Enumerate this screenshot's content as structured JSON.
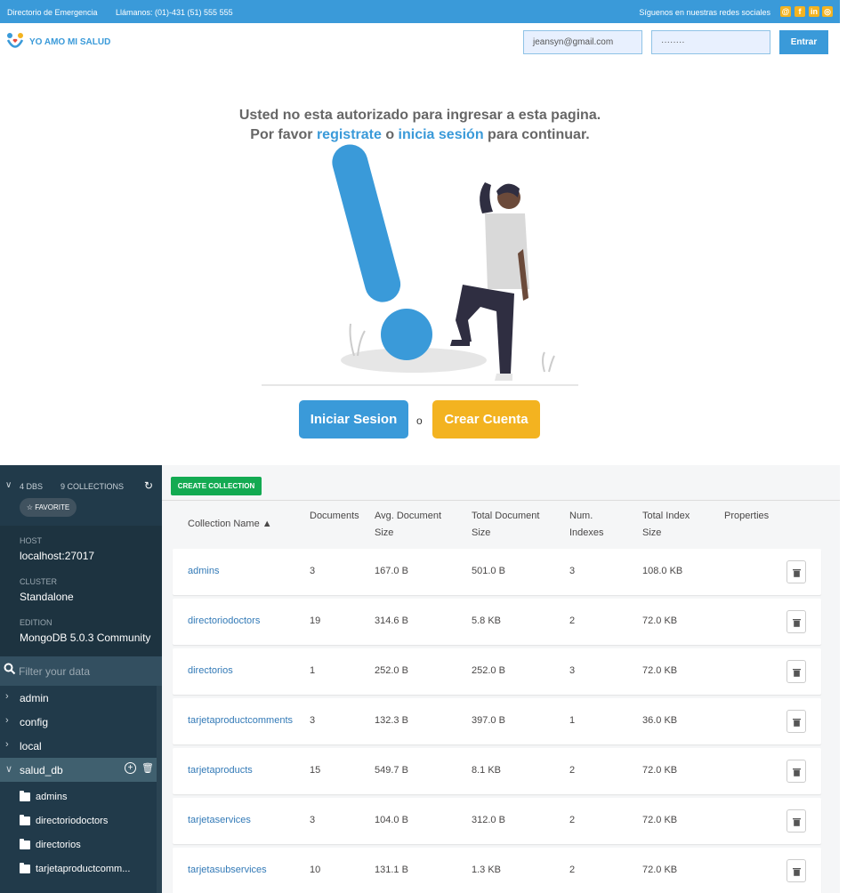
{
  "topbar": {
    "left_text": "Directorio de Emergencia",
    "phone_text": "Llámanos: (01)-431 (51) 555 555",
    "right_text": "Síguenos en nuestras redes sociales",
    "social_icons": [
      "email-icon",
      "facebook-icon",
      "linkedin-icon",
      "instagram-icon"
    ]
  },
  "header": {
    "logo_text": "YO AMO MI SALUD",
    "email_value": "jeansyn@gmail.com",
    "password_value": "········",
    "submit_label": "Entrar"
  },
  "message": {
    "line1": "Usted no esta autorizado para ingresar a esta pagina.",
    "line2_prefix": "Por favor ",
    "register_link": "registrate",
    "connector": " o ",
    "login_link": "inicia sesión",
    "line2_suffix": " para continuar."
  },
  "actions": {
    "login_label": "Iniciar Sesion",
    "separator": "o",
    "create_label": "Crear Cuenta"
  },
  "colors": {
    "brand_blue": "#3a9ad9",
    "brand_yellow": "#f3b320",
    "sidebar_bg": "#213a4a",
    "compass_green": "#13aa52",
    "link_blue": "#337ab7"
  },
  "sidebar": {
    "dbs_label": "4 DBS",
    "collections_label": "9 COLLECTIONS",
    "favorite_label": "☆ FAVORITE",
    "host_label": "HOST",
    "host_value": "localhost:27017",
    "cluster_label": "CLUSTER",
    "cluster_value": "Standalone",
    "edition_label": "EDITION",
    "edition_value": "MongoDB 5.0.3 Community",
    "filter_placeholder": "Filter your data",
    "databases": [
      "admin",
      "config",
      "local",
      "salud_db"
    ],
    "collections": [
      "admins",
      "directoriodoctors",
      "directorios",
      "tarjetaproductcomm..."
    ]
  },
  "main": {
    "create_button": "CREATE COLLECTION",
    "columns": [
      {
        "label": "Collection Name ▲"
      },
      {
        "label": "Documents"
      },
      {
        "label": "Avg. Document Size"
      },
      {
        "label": "Total Document Size"
      },
      {
        "label": "Num. Indexes"
      },
      {
        "label": "Total Index Size"
      },
      {
        "label": "Properties"
      }
    ],
    "rows": [
      {
        "name": "admins",
        "documents": "3",
        "avg": "167.0 B",
        "total": "501.0 B",
        "indexes": "3",
        "index_size": "108.0 KB"
      },
      {
        "name": "directoriodoctors",
        "documents": "19",
        "avg": "314.6 B",
        "total": "5.8 KB",
        "indexes": "2",
        "index_size": "72.0 KB"
      },
      {
        "name": "directorios",
        "documents": "1",
        "avg": "252.0 B",
        "total": "252.0 B",
        "indexes": "3",
        "index_size": "72.0 KB"
      },
      {
        "name": "tarjetaproductcomments",
        "documents": "3",
        "avg": "132.3 B",
        "total": "397.0 B",
        "indexes": "1",
        "index_size": "36.0 KB"
      },
      {
        "name": "tarjetaproducts",
        "documents": "15",
        "avg": "549.7 B",
        "total": "8.1 KB",
        "indexes": "2",
        "index_size": "72.0 KB"
      },
      {
        "name": "tarjetaservices",
        "documents": "3",
        "avg": "104.0 B",
        "total": "312.0 B",
        "indexes": "2",
        "index_size": "72.0 KB"
      },
      {
        "name": "tarjetasubservices",
        "documents": "10",
        "avg": "131.1 B",
        "total": "1.3 KB",
        "indexes": "2",
        "index_size": "72.0 KB"
      }
    ]
  }
}
